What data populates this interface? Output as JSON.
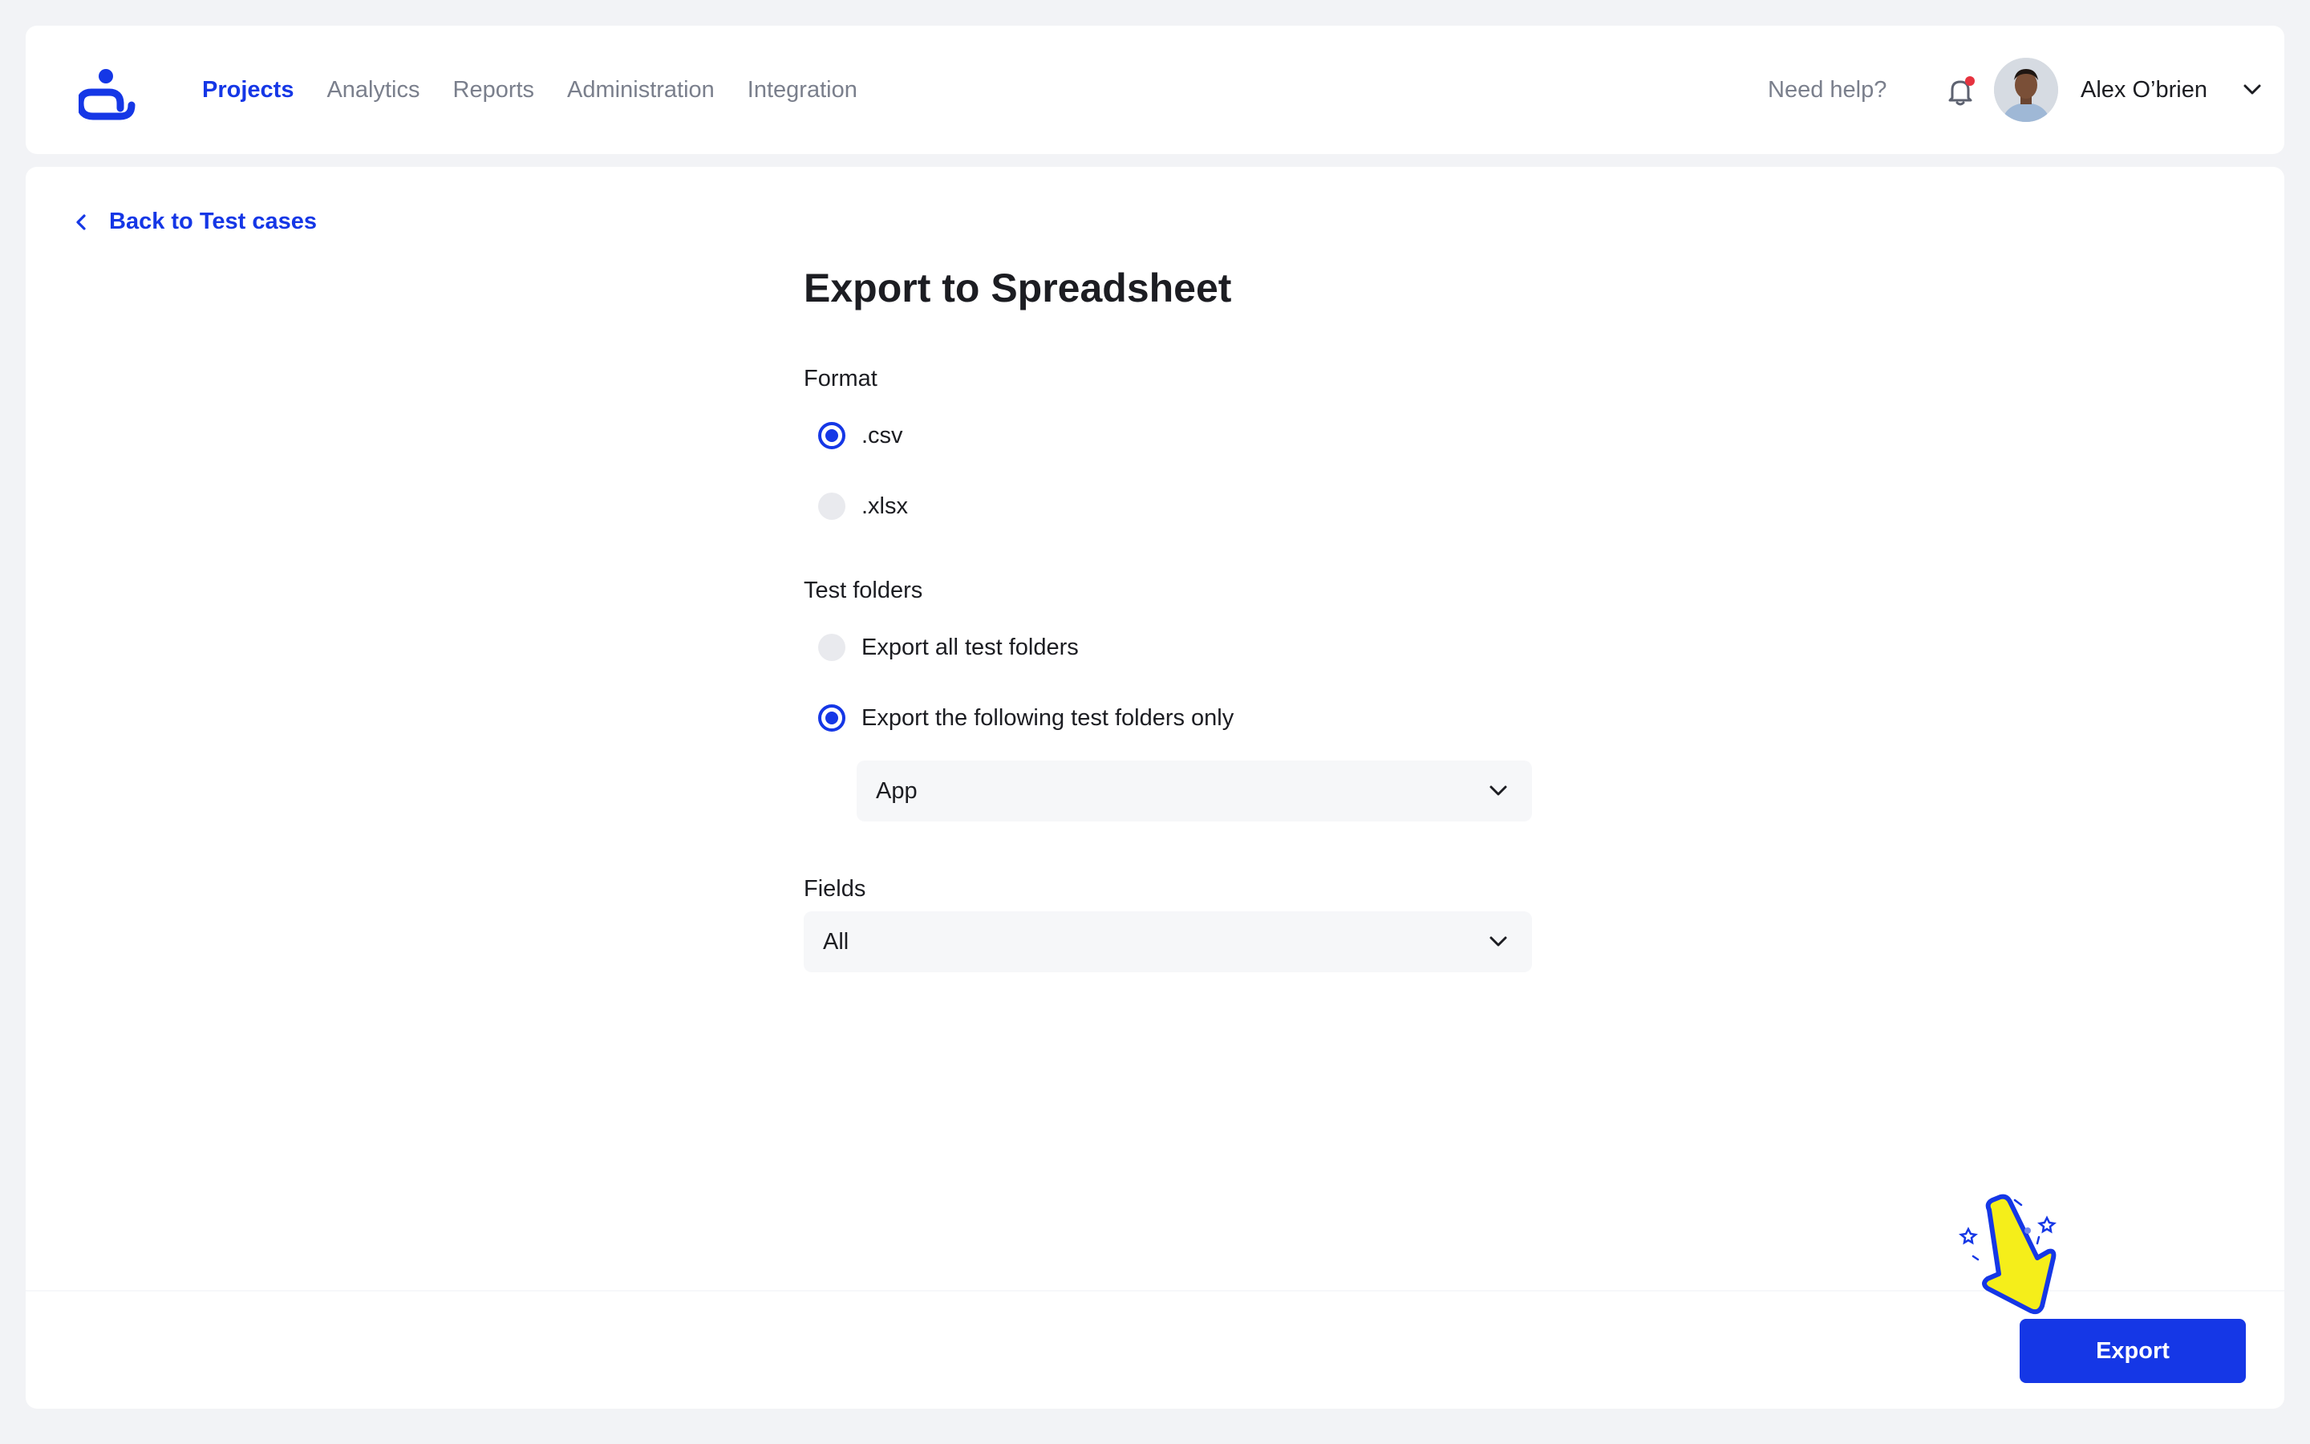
{
  "header": {
    "nav": [
      {
        "label": "Projects",
        "active": true
      },
      {
        "label": "Analytics",
        "active": false
      },
      {
        "label": "Reports",
        "active": false
      },
      {
        "label": "Administration",
        "active": false
      },
      {
        "label": "Integration",
        "active": false
      }
    ],
    "help_label": "Need help?",
    "user_name": "Alex O’brien",
    "notification_unread": true
  },
  "main": {
    "back_label": "Back to Test cases",
    "title": "Export to Spreadsheet",
    "format": {
      "label": "Format",
      "options": [
        {
          "label": ".csv",
          "checked": true
        },
        {
          "label": ".xlsx",
          "checked": false
        }
      ]
    },
    "test_folders": {
      "label": "Test folders",
      "options": [
        {
          "label": "Export all test folders",
          "checked": false
        },
        {
          "label": "Export the following test folders only",
          "checked": true
        }
      ],
      "folder_select_value": "App"
    },
    "fields": {
      "label": "Fields",
      "select_value": "All"
    },
    "export_label": "Export"
  },
  "colors": {
    "accent": "#1537e6",
    "background": "#f2f3f6",
    "notification_dot": "#e6333f",
    "pointer_yellow": "#f5ee1a"
  }
}
